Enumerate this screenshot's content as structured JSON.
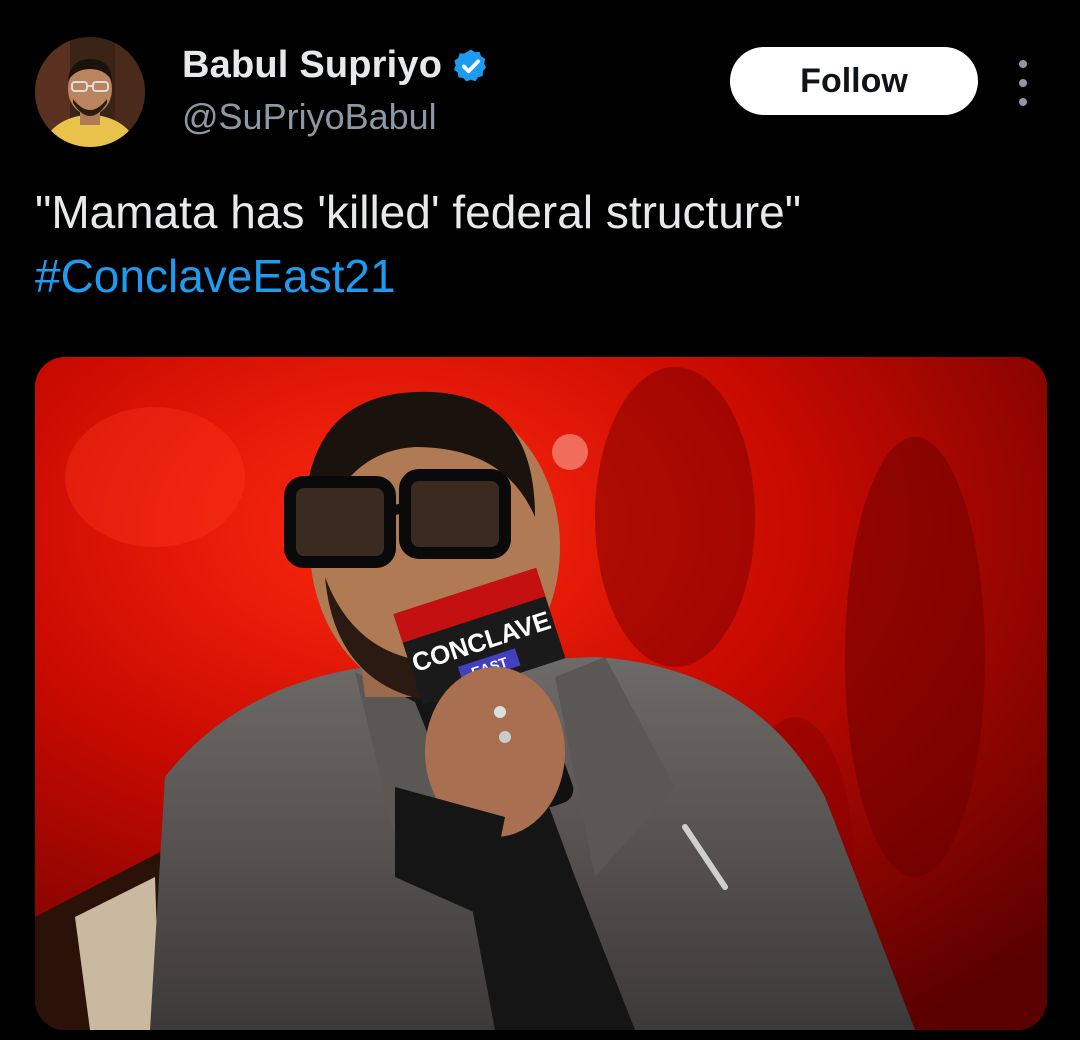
{
  "author": {
    "display_name": "Babul Supriyo",
    "handle": "@SuPriyoBabul",
    "verified": true,
    "verified_icon": "verified-badge-icon",
    "verified_color": "#1d9bf0"
  },
  "actions": {
    "follow_label": "Follow",
    "more_icon": "more-vertical-icon"
  },
  "tweet": {
    "text": "\"Mamata has 'killed' federal structure\"",
    "hashtag": "#ConclaveEast21",
    "hashtag_color": "#1d9bf0"
  },
  "media": {
    "mic_flag_text": "CONCLAVE",
    "mic_flag_subtext": "EAST"
  }
}
